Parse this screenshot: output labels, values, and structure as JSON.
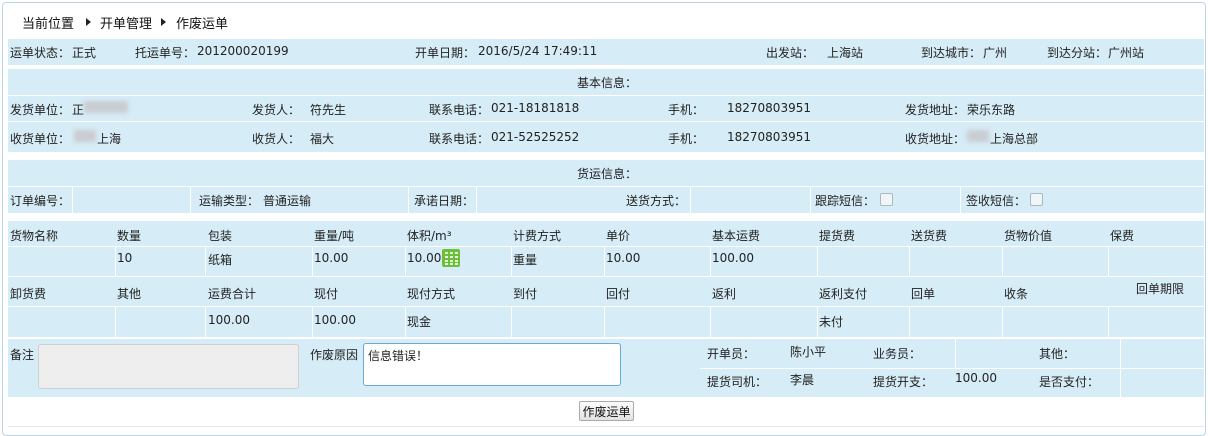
{
  "breadcrumb": {
    "items": [
      "当前位置",
      "开单管理",
      "作废运单"
    ]
  },
  "summary": {
    "status_label": "运单状态：",
    "status_value": "正式",
    "waybill_label": "托运单号：",
    "waybill_value": "201200020199",
    "date_label": "开单日期：",
    "date_value": "2016/5/24 17:49:11",
    "origin_label": "出发站：",
    "origin_value": "上海站",
    "dest_city_label": "到达城市：",
    "dest_city_value": "广州",
    "dest_branch_label": "到达分站：",
    "dest_branch_value": "广州站"
  },
  "basic": {
    "header": "基本信息：",
    "shipper": {
      "unit_label": "发货单位：",
      "unit_value": "正",
      "person_label": "发货人：",
      "person_value": "符先生",
      "phone_label": "联系电话：",
      "phone_value": "021-18181818",
      "mobile_label": "手机：",
      "mobile_value": "18270803951",
      "addr_label": "发货地址：",
      "addr_value": "荣乐东路"
    },
    "receiver": {
      "unit_label": "收货单位：",
      "unit_value": "上海",
      "person_label": "收货人：",
      "person_value": "福大",
      "phone_label": "联系电话：",
      "phone_value": "021-52525252",
      "mobile_label": "手机：",
      "mobile_value": "18270803951",
      "addr_label": "收货地址：",
      "addr_value": "上海总部"
    }
  },
  "cargo": {
    "header": "货运信息：",
    "order_no_label": "订单编号：",
    "transport_label": "运输类型：",
    "transport_value": "普通运输",
    "promise_date_label": "承诺日期：",
    "delivery_label": "送货方式：",
    "track_sms_label": "跟踪短信：",
    "sign_sms_label": "签收短信："
  },
  "goods": {
    "headers1": [
      "货物名称",
      "数量",
      "包装",
      "重量/吨",
      "体积/m³",
      "计费方式",
      "单价",
      "基本运费",
      "提货费",
      "送货费",
      "货物价值",
      "保费"
    ],
    "values1": [
      "",
      "10",
      "纸箱",
      "10.00",
      "10.00",
      "重量",
      "10.00",
      "100.00",
      "",
      "",
      "",
      ""
    ],
    "headers2": [
      "卸货费",
      "其他",
      "运费合计",
      "现付",
      "现付方式",
      "到付",
      "回付",
      "返利",
      "返利支付",
      "回单",
      "收条",
      "回单期限"
    ],
    "values2": [
      "",
      "",
      "100.00",
      "100.00",
      "现金",
      "",
      "",
      "",
      "未付",
      "",
      "",
      ""
    ]
  },
  "footer": {
    "memo_label": "备注",
    "reason_label": "作废原因",
    "reason_value": "信息错误！",
    "creator_label": "开单员：",
    "creator_value": "陈小平",
    "salesman_label": "业务员：",
    "other_label": "其他：",
    "driver_label": "提货司机：",
    "driver_value": "李晨",
    "pickup_cost_label": "提货开支：",
    "pickup_cost_value": "100.00",
    "paid_label": "是否支付：",
    "void_button": "作废运单"
  }
}
